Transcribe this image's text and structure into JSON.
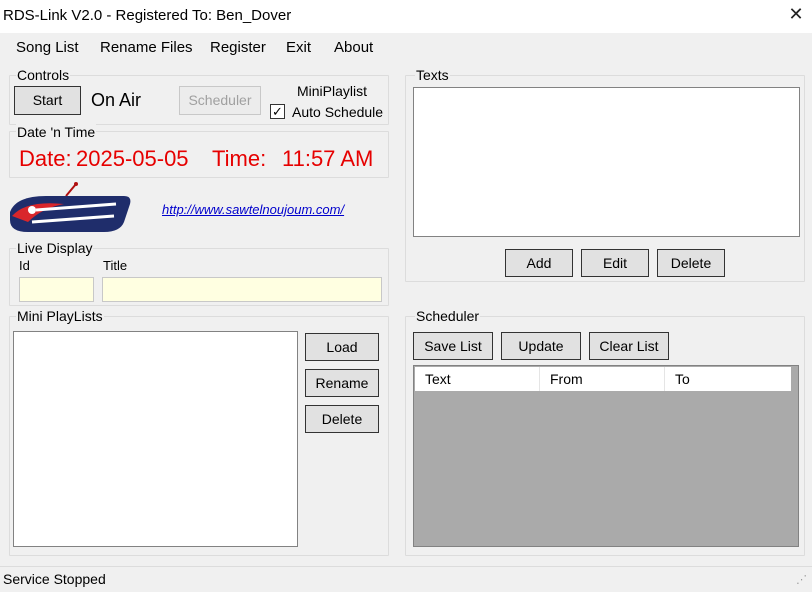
{
  "window": {
    "title": "RDS-Link V2.0 - Registered To: Ben_Dover",
    "close_glyph": "✕"
  },
  "menu": {
    "items": [
      "Song List",
      "Rename Files",
      "Register",
      "Exit",
      "About"
    ]
  },
  "controls": {
    "legend": "Controls",
    "start_label": "Start",
    "on_air_text": "On Air",
    "scheduler_label": "Scheduler",
    "miniplaylist_text": "MiniPlaylist",
    "auto_schedule_label": "Auto Schedule",
    "auto_schedule_checked": true,
    "check_glyph": "✓"
  },
  "datetime": {
    "legend": "Date 'n Time",
    "date_label": "Date:",
    "date_value": "2025-05-05",
    "time_label": "Time:",
    "time_value": "11:57 AM"
  },
  "website": {
    "url": "http://www.sawtelnoujoum.com/"
  },
  "live_display": {
    "legend": "Live Display",
    "id_label": "Id",
    "title_label": "Title",
    "id_value": "",
    "title_value": ""
  },
  "mini_playlists": {
    "legend": "Mini PlayLists",
    "load_label": "Load",
    "rename_label": "Rename",
    "delete_label": "Delete",
    "items": []
  },
  "texts": {
    "legend": "Texts",
    "add_label": "Add",
    "edit_label": "Edit",
    "delete_label": "Delete",
    "items": []
  },
  "scheduler": {
    "legend": "Scheduler",
    "save_list_label": "Save List",
    "update_label": "Update",
    "clear_list_label": "Clear List",
    "columns": [
      "Text",
      "From",
      "To"
    ],
    "rows": []
  },
  "status": {
    "text": "Service Stopped"
  },
  "colors": {
    "accent_red": "#e60000",
    "link_blue": "#0000cc",
    "window_bg": "#f0f0f0",
    "input_yellow": "#ffffe1",
    "listview_empty": "#aaaaaa"
  }
}
